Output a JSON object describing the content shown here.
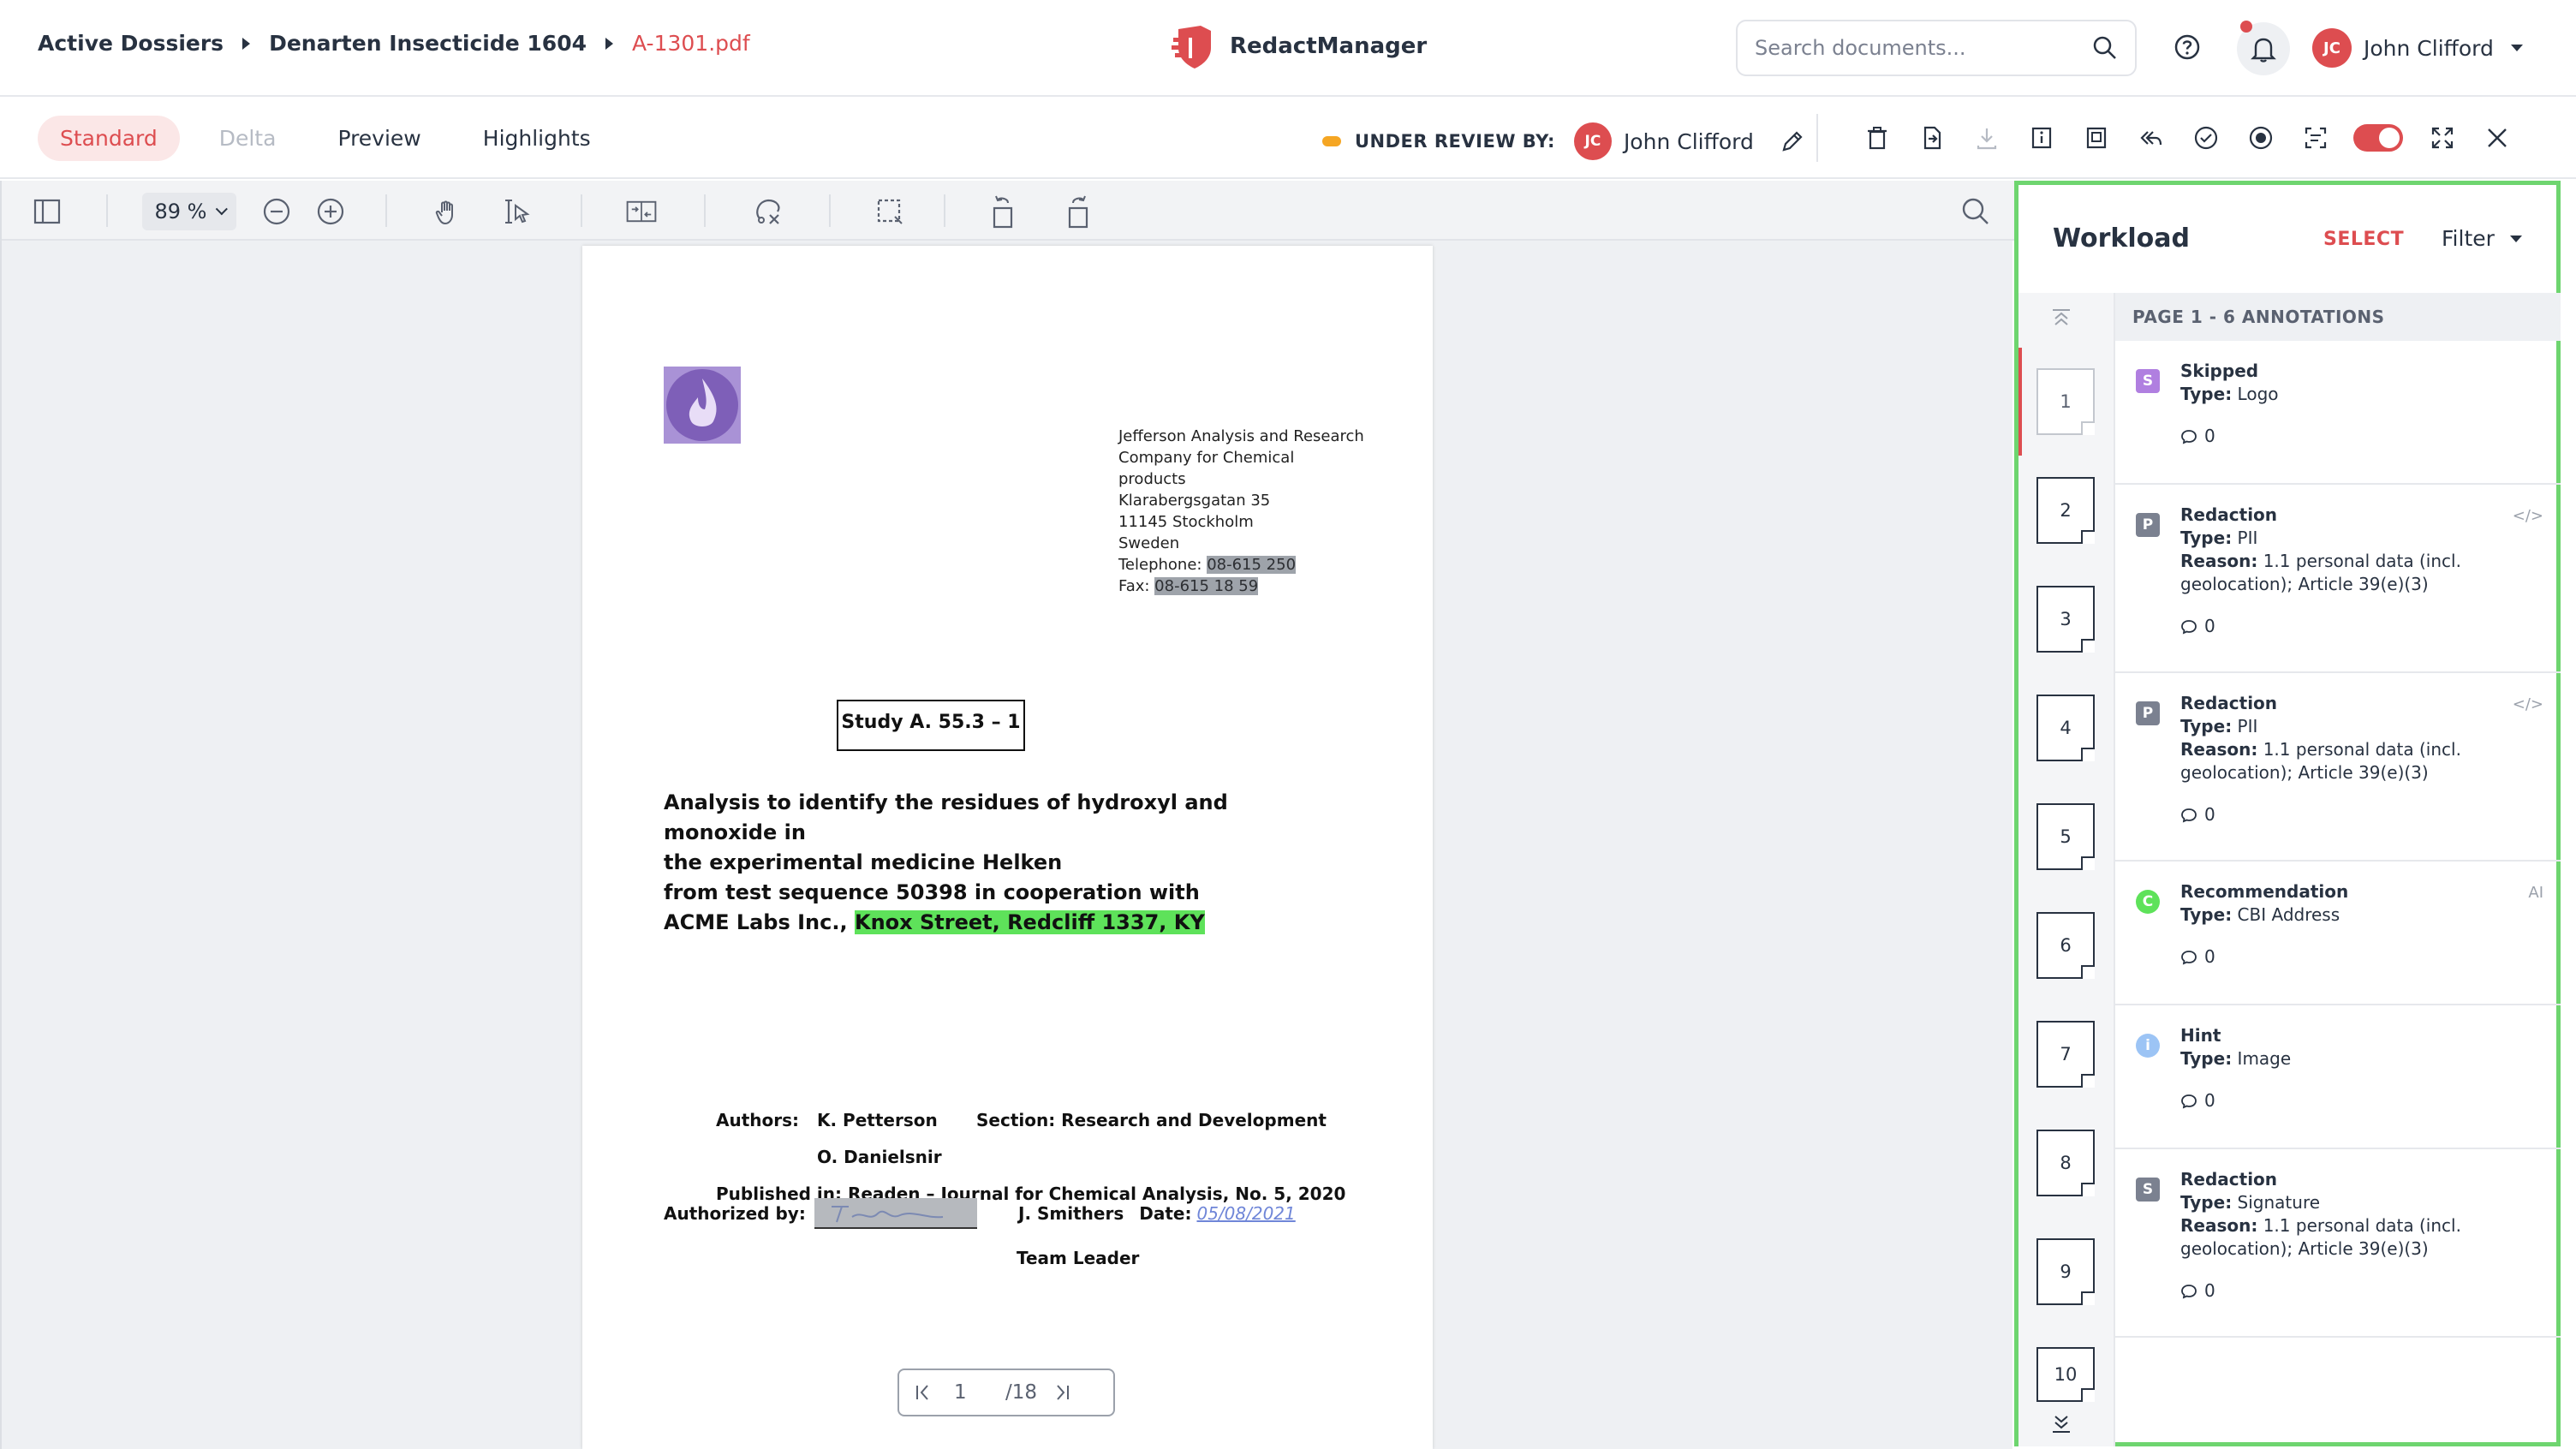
{
  "breadcrumb": {
    "items": [
      "Active Dossiers",
      "Denarten Insecticide 1604"
    ],
    "current": "A-1301.pdf"
  },
  "app": {
    "name": "RedactManager"
  },
  "search": {
    "placeholder": "Search documents..."
  },
  "user": {
    "initials": "JC",
    "name": "John Clifford"
  },
  "tabs": [
    {
      "label": "Standard",
      "state": "active"
    },
    {
      "label": "Delta",
      "state": "disabled"
    },
    {
      "label": "Preview",
      "state": "normal"
    },
    {
      "label": "Highlights",
      "state": "normal"
    }
  ],
  "review": {
    "label": "UNDER REVIEW BY:",
    "initials": "JC",
    "name": "John Clifford"
  },
  "viewer": {
    "zoom": "89 %",
    "page_current": "1",
    "page_total": "/18"
  },
  "document": {
    "address": [
      "Jefferson Analysis and Research",
      "Company for Chemical",
      "products",
      "Klarabergsgatan 35",
      "11145 Stockholm",
      "Sweden"
    ],
    "telephone_label": "Telephone: ",
    "telephone": "08-615 250",
    "fax_label": "Fax: ",
    "fax": "08-615 18 59",
    "study": "Study A. 55.3 – 1",
    "title_lines": [
      "Analysis to identify the residues of hydroxyl and monoxide in",
      "the experimental medicine Helken",
      "from test sequence 50398 in cooperation with"
    ],
    "title_last_prefix": "ACME Labs Inc., ",
    "title_last_highlight": "Knox Street, Redcliff 1337, KY",
    "authors_label": "Authors:",
    "author1": "K. Petterson",
    "section": "Section: Research and Development",
    "author2": "O. Danielsnir",
    "published": "Published in: Readen – Journal for Chemical Analysis, No. 5, 2020",
    "authorized_label": "Authorized by:",
    "signer": "J. Smithers",
    "date_label": "Date:",
    "date_value": "05/08/2021",
    "signer_role": "Team Leader"
  },
  "workload": {
    "title": "Workload",
    "select_label": "SELECT",
    "filter_label": "Filter",
    "list_header": "PAGE 1 - 6 ANNOTATIONS",
    "pages": [
      "1",
      "2",
      "3",
      "4",
      "5",
      "6",
      "7",
      "8",
      "9",
      "10"
    ],
    "annotations": [
      {
        "badge": "S",
        "badge_color": "#b07fe0",
        "title": "Skipped",
        "type_label": "Type:",
        "type": "Logo",
        "reason_label": "",
        "reason": "",
        "comments": "0",
        "corner": ""
      },
      {
        "badge": "P",
        "badge_color": "#7b8190",
        "title": "Redaction",
        "type_label": "Type:",
        "type": "PII",
        "reason_label": "Reason:",
        "reason": "1.1 personal data (incl. geolocation); Article 39(e)(3)",
        "comments": "0",
        "corner": "</>"
      },
      {
        "badge": "P",
        "badge_color": "#7b8190",
        "title": "Redaction",
        "type_label": "Type:",
        "type": "PII",
        "reason_label": "Reason:",
        "reason": "1.1 personal data (incl. geolocation); Article 39(e)(3)",
        "comments": "0",
        "corner": "</>"
      },
      {
        "badge": "C",
        "badge_color": "#5ee25a",
        "title": "Recommendation",
        "type_label": "Type:",
        "type": "CBI Address",
        "reason_label": "",
        "reason": "",
        "comments": "0",
        "corner": "AI"
      },
      {
        "badge": "i",
        "badge_color": "#9cc4f5",
        "title": "Hint",
        "type_label": "Type:",
        "type": "Image",
        "reason_label": "",
        "reason": "",
        "comments": "0",
        "corner": ""
      },
      {
        "badge": "S",
        "badge_color": "#7b8190",
        "title": "Redaction",
        "type_label": "Type:",
        "type": "Signature",
        "reason_label": "Reason:",
        "reason": "1.1 personal data (incl. geolocation); Article 39(e)(3)",
        "comments": "0",
        "corner": ""
      }
    ]
  },
  "colors": {
    "accent": "#dd4d50",
    "panel_border": "#6ed56f",
    "highlight_green": "#5ee25a",
    "review_dot": "#f5a623"
  }
}
